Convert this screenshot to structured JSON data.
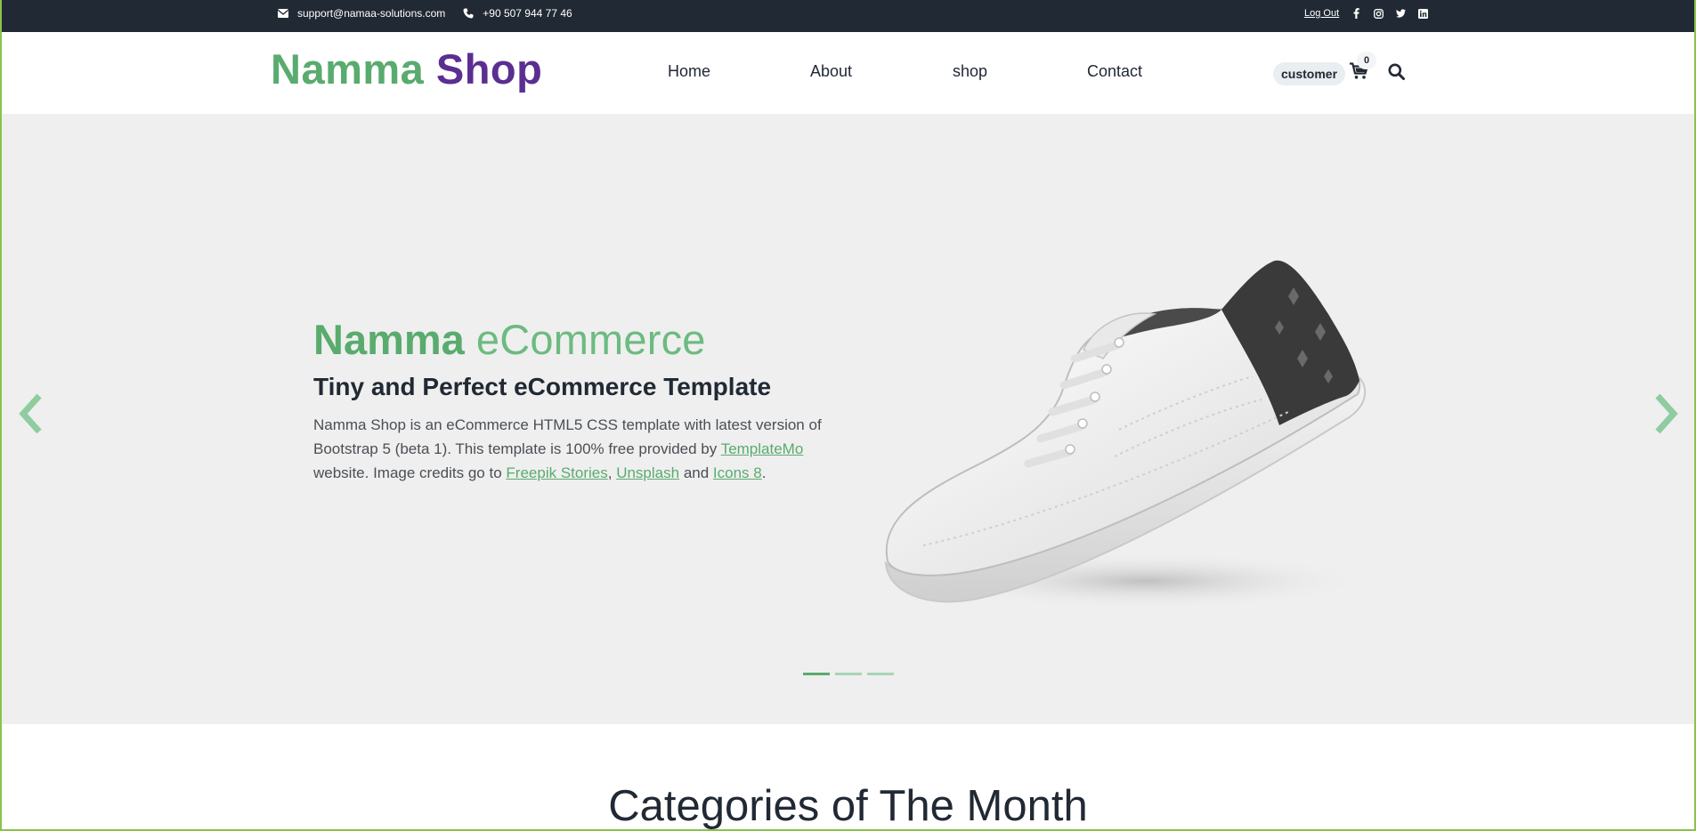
{
  "topbar": {
    "email": "support@namaa-solutions.com",
    "phone": "+90 507 944 77 46",
    "logout": "Log Out",
    "social": [
      "facebook-icon",
      "instagram-icon",
      "twitter-icon",
      "linkedin-icon"
    ]
  },
  "brand": {
    "part1": "Namma",
    "part2": "Shop"
  },
  "nav": {
    "home": "Home",
    "about": "About",
    "shop": "shop",
    "contact": "Contact"
  },
  "header": {
    "user": "customer",
    "cart_count": "0"
  },
  "hero": {
    "title_strong": "Namma",
    "title_light": "eCommerce",
    "subtitle": "Tiny and Perfect eCommerce Template",
    "text_1": "Namma Shop is an eCommerce HTML5 CSS template with latest version of Bootstrap 5 (beta 1). This template is 100% free provided by",
    "link_templatemo": "TemplateMo",
    "text_2": "website. Image credits go to",
    "link_freepik": "Freepik Stories",
    "comma": ",",
    "link_unsplash": "Unsplash",
    "text_3": "and",
    "link_icons8": "Icons 8",
    "period": ".",
    "slides": 3,
    "active_slide": 1
  },
  "section": {
    "title": "Categories of The Month"
  },
  "colors": {
    "green": "#59ab6e",
    "purple": "#5b2e91",
    "dark": "#212934",
    "hero_bg": "#efefef"
  }
}
